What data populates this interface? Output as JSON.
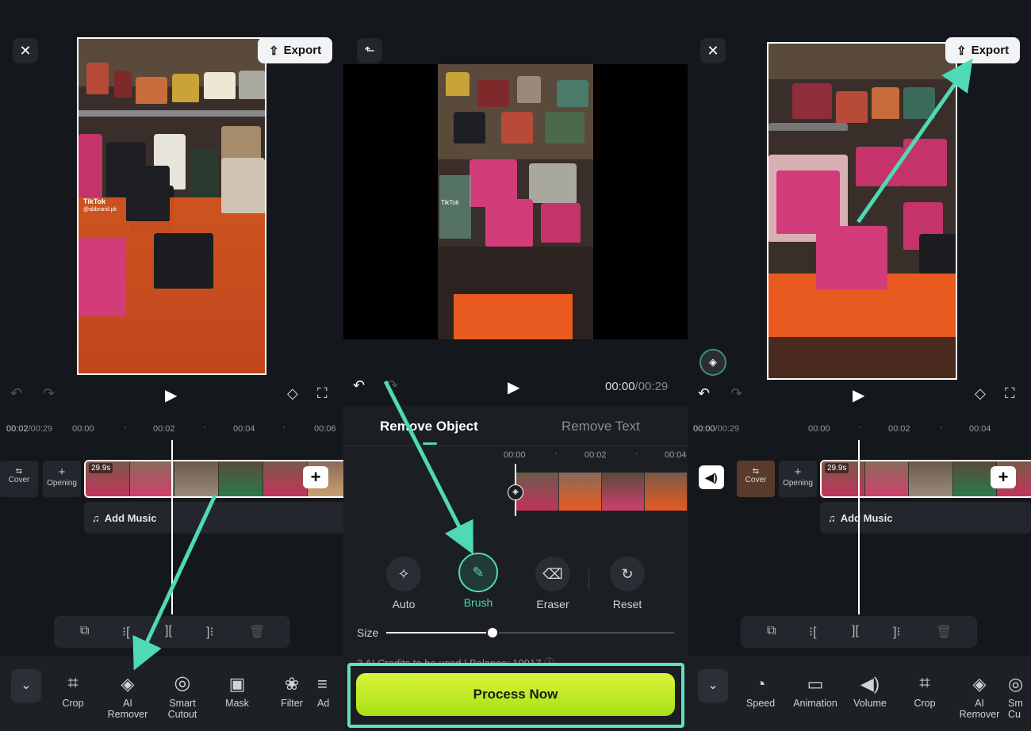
{
  "panel1": {
    "export_label": "Export",
    "watermark": "TikTok",
    "watermark_handle": "@abbrand.pk",
    "time_current": "00:02",
    "time_total": "/00:29",
    "ticks": [
      "00:00",
      "00:02",
      "00:04",
      "00:06"
    ],
    "clip_duration": "29.9s",
    "cover_label": "Cover",
    "opening_label": "Opening",
    "add_music": "Add Music",
    "tools": [
      "Crop",
      "AI Remover",
      "Smart Cutout",
      "Mask",
      "Filter",
      "Ad"
    ]
  },
  "panel2": {
    "watermark": "TikTok",
    "time_current": "00:00",
    "time_total": "/00:29",
    "tab_remove_object": "Remove Object",
    "tab_remove_text": "Remove Text",
    "ticks": [
      "00:00",
      "00:02",
      "00:04"
    ],
    "options": [
      "Auto",
      "Brush",
      "Eraser",
      "Reset"
    ],
    "size_label": "Size",
    "size_value": 0.37,
    "credits_text": "3 AI Credits to be used | Balance: 10917",
    "process_label": "Process Now"
  },
  "panel3": {
    "export_label": "Export",
    "time_current": "00:00",
    "time_total": "/00:29",
    "ticks": [
      "00:00",
      "00:02",
      "00:04"
    ],
    "clip_duration": "29.9s",
    "cover_label": "Cover",
    "opening_label": "Opening",
    "add_music": "Add Music",
    "tools": [
      "Speed",
      "Animation",
      "Volume",
      "Crop",
      "AI Remover",
      "Sm Cu"
    ]
  },
  "colors": {
    "accent_teal": "#4fd9b5",
    "process_green": "#c6f21a",
    "highlight_box": "#63e0c0"
  }
}
